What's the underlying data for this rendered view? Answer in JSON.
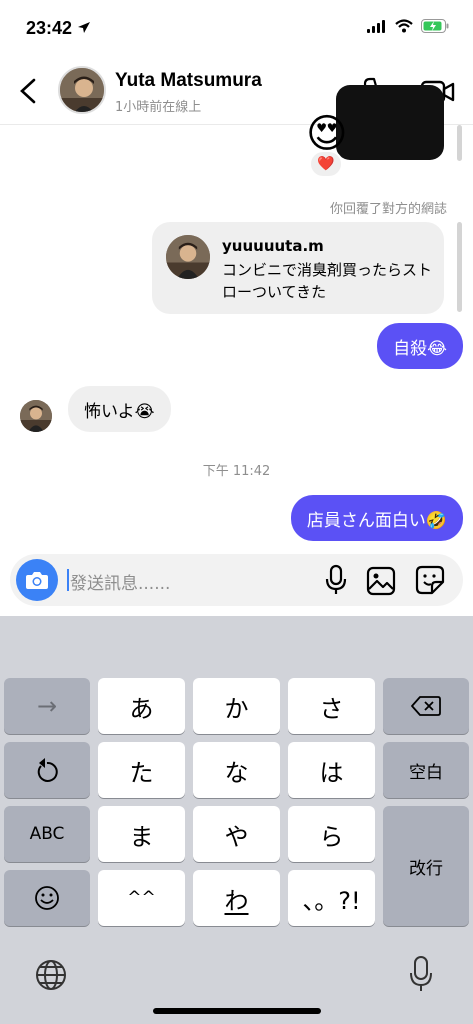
{
  "status_bar": {
    "time": "23:42"
  },
  "header": {
    "name": "Yuta Matsumura",
    "status": "1小時前在線上"
  },
  "chat": {
    "media_emoji": "😍",
    "reaction_emoji": "❤️",
    "replied_notice": "你回覆了對方的網誌",
    "story": {
      "username": "yuuuuuta.m",
      "text": "コンビニで消臭剤買ったらストローついてきた"
    },
    "messages": [
      {
        "direction": "out",
        "text": "自殺😂"
      },
      {
        "direction": "in",
        "text": "怖いよ😭"
      },
      {
        "direction": "out",
        "text": "店員さん面白い🤣"
      }
    ],
    "timestamp": "下午 11:42"
  },
  "composer": {
    "placeholder": "發送訊息......"
  },
  "keyboard": {
    "row1": [
      "→",
      "あ",
      "か",
      "さ",
      "⌫"
    ],
    "row2": [
      "↺",
      "た",
      "な",
      "は",
      "空白"
    ],
    "row3": [
      "ABC",
      "ま",
      "や",
      "ら",
      "改行"
    ],
    "row4": [
      "☺",
      "^^",
      "わ",
      "、。?!"
    ]
  },
  "colors": {
    "outgoing_bubble": "#5b51f5",
    "incoming_bubble": "#efefef",
    "camera_button": "#3b82f6"
  }
}
